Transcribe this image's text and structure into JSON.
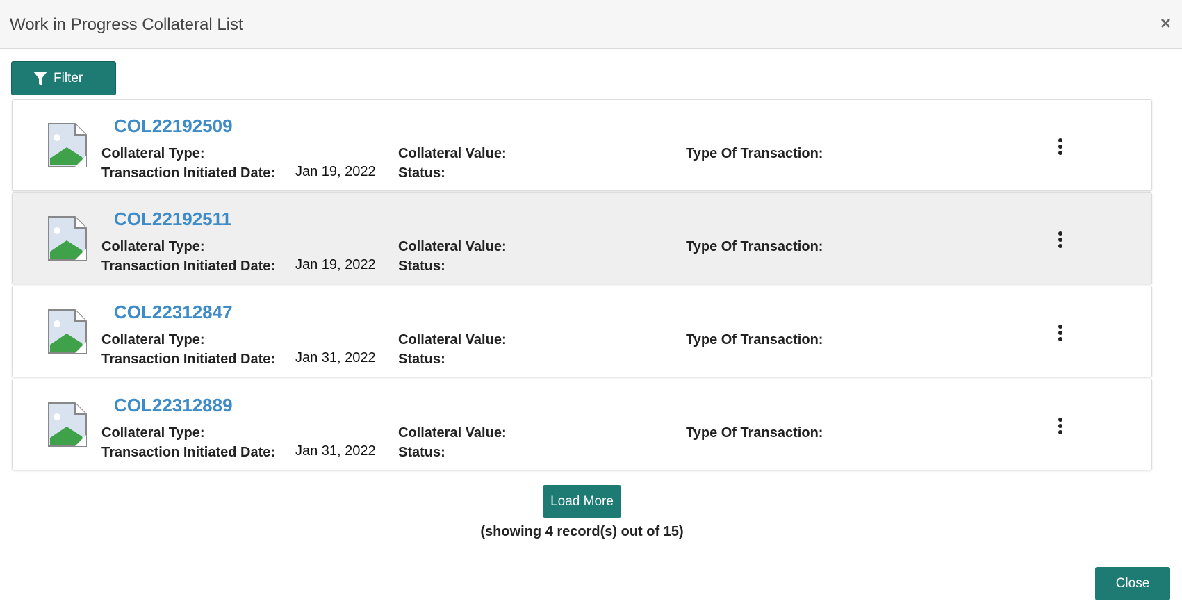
{
  "dialog": {
    "title": "Work in Progress Collateral List",
    "close_icon": "×"
  },
  "toolbar": {
    "filter_label": "Filter"
  },
  "labels": {
    "collateral_type": "Collateral Type:",
    "transaction_initiated_date": "Transaction Initiated Date:",
    "collateral_value": "Collateral Value:",
    "status": "Status:",
    "type_of_transaction": "Type Of Transaction:"
  },
  "records": [
    {
      "id": "COL22192509",
      "date": "Jan 19, 2022"
    },
    {
      "id": "COL22192511",
      "date": "Jan 19, 2022"
    },
    {
      "id": "COL22312847",
      "date": "Jan 31, 2022"
    },
    {
      "id": "COL22312889",
      "date": "Jan 31, 2022"
    }
  ],
  "pagination": {
    "load_more_label": "Load More",
    "showing_text": "(showing 4 record(s) out of 15)"
  },
  "footer": {
    "close_label": "Close"
  },
  "colors": {
    "accent": "#1e7b74",
    "link": "#3d8bc9"
  }
}
